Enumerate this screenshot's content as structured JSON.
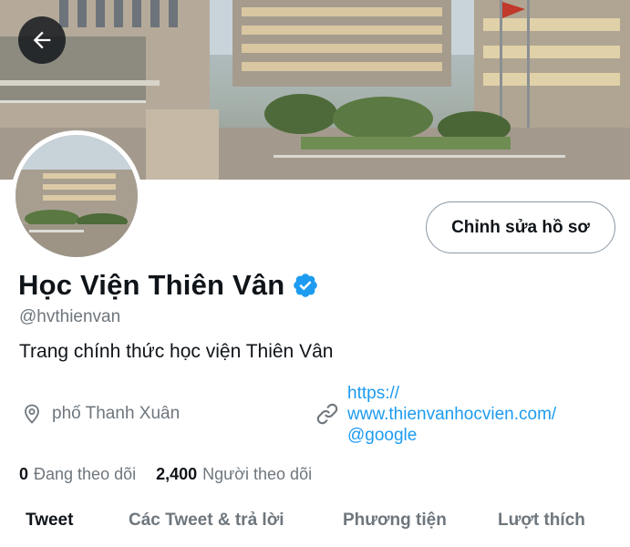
{
  "header": {
    "back_icon": "arrow-left-icon"
  },
  "profile": {
    "name": "Học Viện Thiên Vân",
    "verified_icon": "verified-badge-icon",
    "verified_color": "#1d9bf0",
    "handle": "@hvthienvan",
    "bio": "Trang chính thức học viện Thiên Vân",
    "location": "phố Thanh Xuân",
    "location_icon": "location-pin-icon",
    "link_icon": "link-icon",
    "link_lines": [
      "https://",
      "www.thienvanhocvien.com/",
      "@google"
    ],
    "edit_button": "Chỉnh sửa hồ sơ"
  },
  "stats": {
    "following_count": "0",
    "following_label": "Đang theo dõi",
    "followers_count": "2,400",
    "followers_label": "Người theo dõi"
  },
  "tabs": [
    {
      "label": "Tweet",
      "active": true
    },
    {
      "label": "Các Tweet & trả lời",
      "active": false
    },
    {
      "label": "Phương tiện",
      "active": false
    },
    {
      "label": "Lượt thích",
      "active": false
    }
  ],
  "colors": {
    "accent": "#1d9bf0",
    "text_primary": "#0f1419",
    "text_secondary": "#6e767d"
  }
}
